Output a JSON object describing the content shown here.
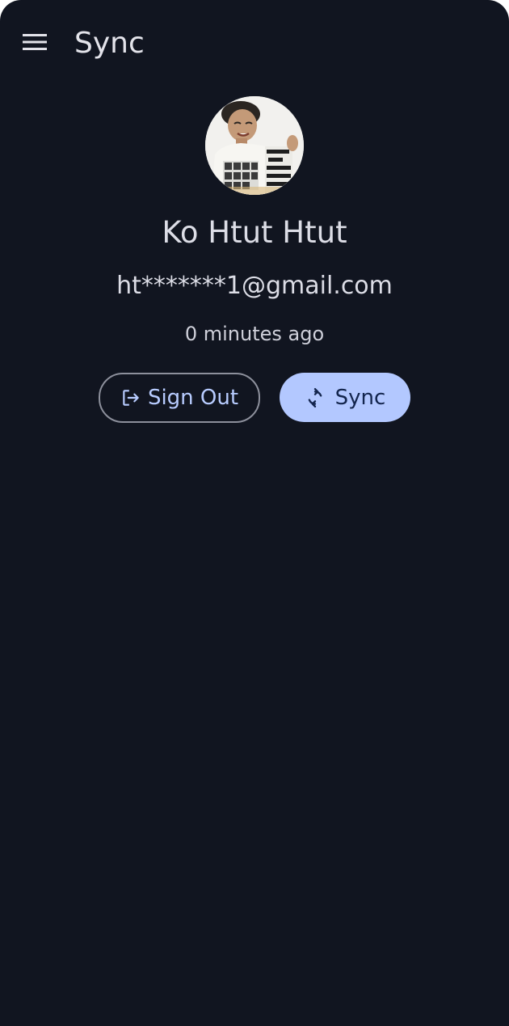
{
  "app_bar": {
    "menu_icon": "hamburger-menu-icon",
    "title": "Sync"
  },
  "profile": {
    "avatar": "profile-photo",
    "name": "Ko Htut Htut",
    "email": "ht*******1@gmail.com",
    "last_sync": "0 minutes ago"
  },
  "actions": {
    "sign_out": {
      "label": "Sign Out",
      "icon": "logout-icon"
    },
    "sync": {
      "label": "Sync",
      "icon": "sync-icon"
    }
  },
  "colors": {
    "background": "#111520",
    "primary_container": "#b3c8ff",
    "on_primary_container": "#13254d",
    "outline": "#8d909c",
    "accent_text": "#b8ccff",
    "text": "#dcdde6"
  }
}
